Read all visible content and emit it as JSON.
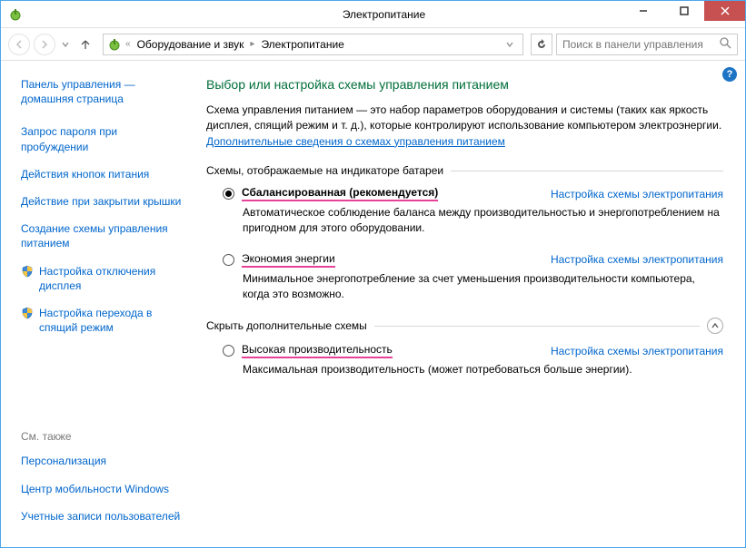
{
  "window": {
    "title": "Электропитание"
  },
  "breadcrumb": {
    "item1": "Оборудование и звук",
    "item2": "Электропитание"
  },
  "search": {
    "placeholder": "Поиск в панели управления"
  },
  "sidebar": {
    "home": "Панель управления — домашняя страница",
    "links": {
      "wake_password": "Запрос пароля при пробуждении",
      "button_actions": "Действия кнопок питания",
      "lid_action": "Действие при закрытии крышки",
      "create_plan": "Создание схемы управления питанием",
      "display_off": "Настройка отключения дисплея",
      "sleep": "Настройка перехода в спящий режим"
    },
    "see_also_header": "См. также",
    "see_also": {
      "personalization": "Персонализация",
      "mobility": "Центр мобильности Windows",
      "accounts": "Учетные записи пользователей"
    }
  },
  "main": {
    "heading": "Выбор или настройка схемы управления питанием",
    "description_pre": "Схема управления питанием — это набор параметров оборудования и системы (таких как яркость дисплея, спящий режим и т. д.), которые контролируют использование компьютером электроэнергии. ",
    "description_link": "Дополнительные сведения о схемах управления питанием",
    "section1": "Схемы, отображаемые на индикаторе батареи",
    "section2": "Скрыть дополнительные схемы",
    "change_link": "Настройка схемы электропитания",
    "plans": {
      "balanced": {
        "name": "Сбалансированная (рекомендуется)",
        "desc": "Автоматическое соблюдение баланса между производительностью и энергопотреблением на пригодном для этого оборудовании."
      },
      "saver": {
        "name": "Экономия энергии",
        "desc": "Минимальное энергопотребление за счет уменьшения производительности компьютера, когда это возможно."
      },
      "high": {
        "name": "Высокая производительность",
        "desc": "Максимальная производительность (может потребоваться больше энергии)."
      }
    }
  }
}
